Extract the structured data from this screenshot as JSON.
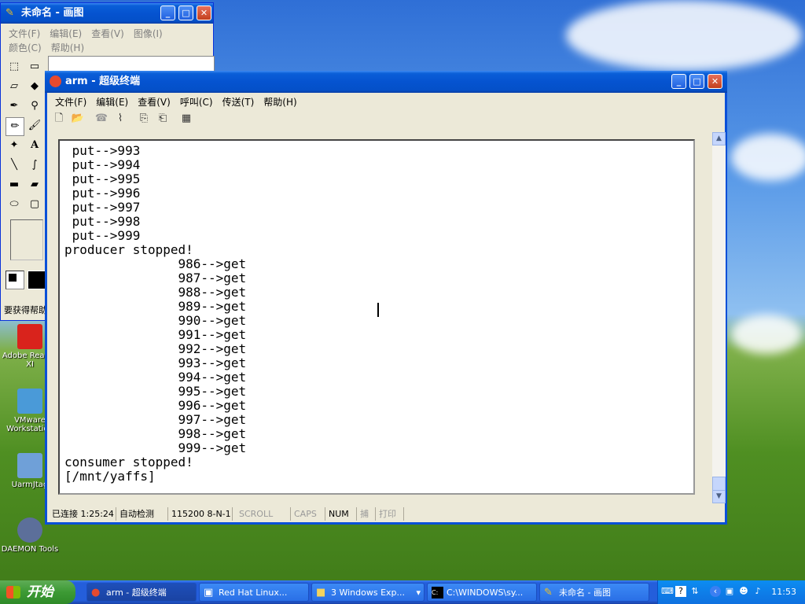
{
  "paint": {
    "title": "未命名 - 画图",
    "menu_row1": [
      "文件(F)",
      "编辑(E)",
      "查看(V)",
      "图像(I)"
    ],
    "menu_row2": [
      "颜色(C)",
      "帮助(H)"
    ],
    "status_hint": "要获得帮助"
  },
  "terminal": {
    "title": "arm - 超级终端",
    "menu": [
      "文件(F)",
      "编辑(E)",
      "查看(V)",
      "呼叫(C)",
      "传送(T)",
      "帮助(H)"
    ],
    "lines": [
      " put-->993",
      " put-->994",
      " put-->995",
      " put-->996",
      " put-->997",
      " put-->998",
      " put-->999",
      "producer stopped!",
      "               986-->get",
      "               987-->get",
      "               988-->get",
      "               989-->get",
      "               990-->get",
      "               991-->get",
      "               992-->get",
      "               993-->get",
      "               994-->get",
      "               995-->get",
      "               996-->get",
      "               997-->get",
      "               998-->get",
      "               999-->get",
      "consumer stopped!",
      "[/mnt/yaffs]"
    ],
    "status": {
      "connection": "已连接 1:25:24",
      "detect": "自动检测",
      "port": "115200 8-N-1",
      "scroll": "SCROLL",
      "caps": "CAPS",
      "num": "NUM",
      "capture": "捕",
      "print": "打印"
    }
  },
  "desktop_icons": [
    {
      "label": "Adobe Reader XI",
      "color": "#d9231c"
    },
    {
      "label": "VMware Workstation",
      "color": "#4a9ad8"
    },
    {
      "label": "UarmJtag",
      "color": "#6fa0d8"
    },
    {
      "label": "DAEMON Tools",
      "color": "#5c6f9a"
    }
  ],
  "taskbar": {
    "start_label": "开始",
    "tasks": [
      {
        "label": "arm - 超级终端",
        "icon": "hyperterminal-icon"
      },
      {
        "label": "Red Hat Linux...",
        "icon": "vm-icon"
      },
      {
        "label": "3 Windows Exp...",
        "icon": "folder-icon"
      },
      {
        "label": "C:\\WINDOWS\\sy...",
        "icon": "cmd-icon"
      },
      {
        "label": "未命名 - 画图",
        "icon": "paint-icon"
      }
    ],
    "clock": "11:53"
  }
}
